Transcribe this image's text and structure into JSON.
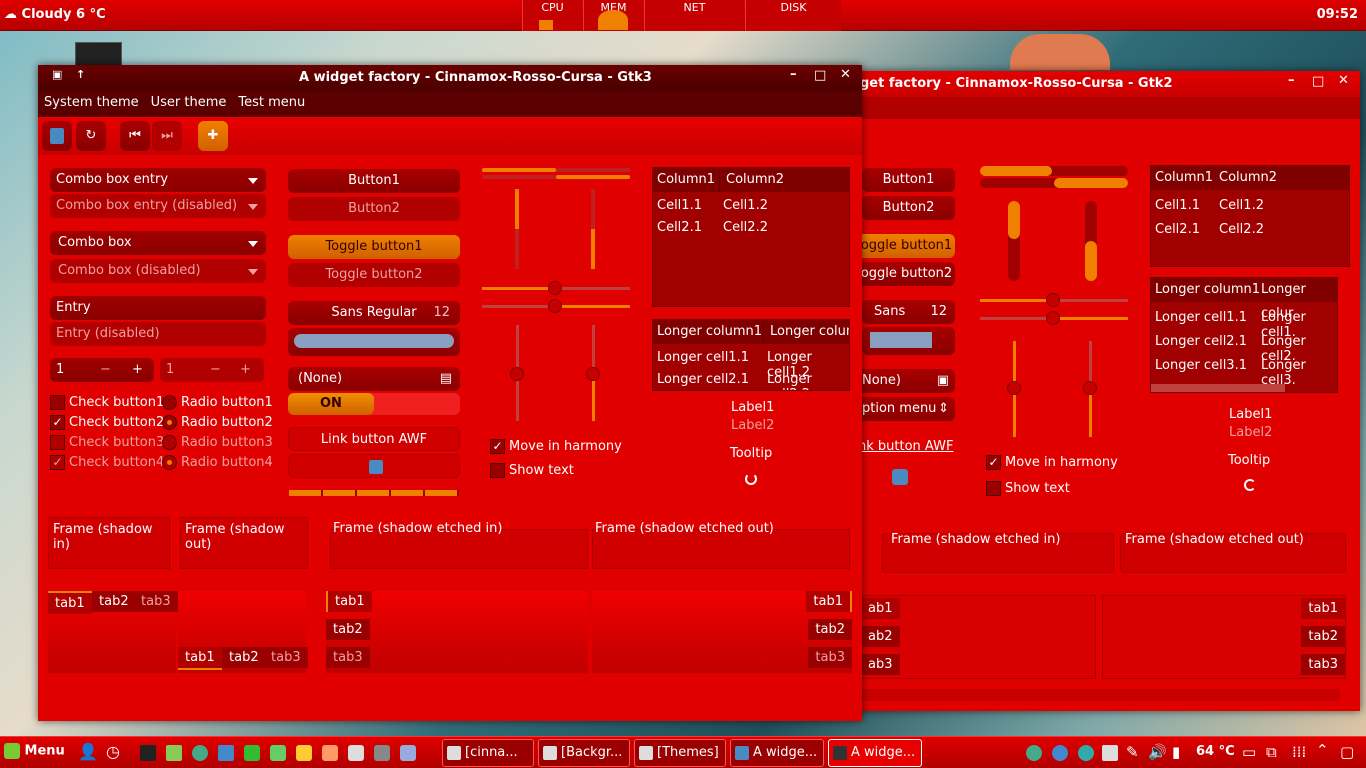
{
  "top_panel": {
    "weather": "Cloudy 6 °C",
    "clock": "09:52",
    "monitors": [
      "CPU",
      "MEM",
      "NET",
      "DISK"
    ]
  },
  "gtk3": {
    "title": "A widget factory - Cinnamox-Rosso-Cursa - Gtk3",
    "menus": [
      "System theme",
      "User theme",
      "Test menu"
    ],
    "combo1": "Combo box entry",
    "combo1_dis": "Combo box entry (disabled)",
    "combo2": "Combo box",
    "combo2_dis": "Combo box (disabled)",
    "entry": "Entry",
    "entry_dis": "Entry (disabled)",
    "spin1": "1",
    "spin2": "1",
    "checks": [
      "Check button1",
      "Check button2",
      "Check button3",
      "Check button4"
    ],
    "radios": [
      "Radio button1",
      "Radio button2",
      "Radio button3",
      "Radio button4"
    ],
    "button1": "Button1",
    "button2": "Button2",
    "toggle1": "Toggle button1",
    "toggle2": "Toggle button2",
    "font_name": "Sans Regular",
    "font_size": "12",
    "file_chooser": "(None)",
    "switch": "ON",
    "link": "Link button AWF",
    "move_harmony": "Move in harmony",
    "show_text": "Show text",
    "tree1": {
      "cols": [
        "Column1",
        "Column2"
      ],
      "rows": [
        [
          "Cell1.1",
          "Cell1.2"
        ],
        [
          "Cell2.1",
          "Cell2.2"
        ]
      ]
    },
    "tree2": {
      "cols": [
        "Longer column1",
        "Longer colum"
      ],
      "rows": [
        [
          "Longer cell1.1",
          "Longer cell1.2"
        ],
        [
          "Longer cell2.1",
          "Longer cell2.2"
        ]
      ]
    },
    "label1": "Label1",
    "label2": "Label2",
    "tooltip": "Tooltip",
    "frames": [
      "Frame (shadow in)",
      "Frame (shadow out)",
      "Frame (shadow etched in)",
      "Frame (shadow etched out)"
    ],
    "tabs": [
      "tab1",
      "tab2",
      "tab3"
    ]
  },
  "gtk2": {
    "title": "get factory - Cinnamox-Rosso-Cursa - Gtk2",
    "button1": "Button1",
    "button2": "Button2",
    "toggle1": "oggle button1",
    "toggle2": "oggle button2",
    "font_name": "Sans",
    "font_size": "12",
    "file_chooser": "None)",
    "option_menu": "ption menu",
    "link": "nk button AWF",
    "move_harmony": "Move in harmony",
    "show_text": "Show text",
    "tree1": {
      "cols": [
        "Column1",
        "Column2"
      ],
      "rows": [
        [
          "Cell1.1",
          "Cell1.2"
        ],
        [
          "Cell2.1",
          "Cell2.2"
        ]
      ]
    },
    "tree2": {
      "cols": [
        "Longer column1",
        "Longer colur"
      ],
      "rows": [
        [
          "Longer cell1.1",
          "Longer cell1."
        ],
        [
          "Longer cell2.1",
          "Longer cell2."
        ],
        [
          "Longer cell3.1",
          "Longer cell3."
        ]
      ]
    },
    "label1": "Label1",
    "label2": "Label2",
    "tooltip": "Tooltip",
    "frames": [
      "Frame (shadow etched in)",
      "Frame (shadow etched out)"
    ],
    "tabs_left": [
      "ab1",
      "ab2",
      "ab3"
    ],
    "tabs_right": [
      "tab1",
      "tab2",
      "tab3"
    ]
  },
  "taskbar": {
    "menu": "Menu",
    "tasks": [
      "[cinna...",
      "[Backgr...",
      "[Themes]",
      "A widge...",
      "A widge..."
    ],
    "temp": "64 °C"
  }
}
